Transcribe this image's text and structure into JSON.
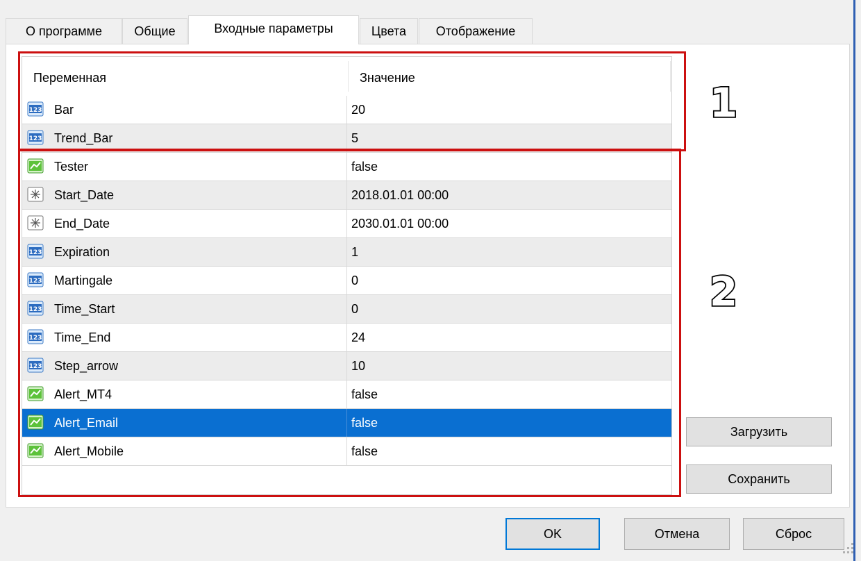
{
  "tabs": [
    {
      "label": "О программе",
      "active": false
    },
    {
      "label": "Общие",
      "active": false
    },
    {
      "label": "Входные параметры",
      "active": true
    },
    {
      "label": "Цвета",
      "active": false
    },
    {
      "label": "Отображение",
      "active": false
    }
  ],
  "grid": {
    "headers": {
      "variable": "Переменная",
      "value": "Значение"
    },
    "rows": [
      {
        "icon": "number-icon",
        "name": "Bar",
        "value": "20"
      },
      {
        "icon": "number-icon",
        "name": "Trend_Bar",
        "value": "5"
      },
      {
        "icon": "boolean-icon",
        "name": "Tester",
        "value": "false"
      },
      {
        "icon": "datetime-icon",
        "name": "Start_Date",
        "value": "2018.01.01 00:00"
      },
      {
        "icon": "datetime-icon",
        "name": "End_Date",
        "value": "2030.01.01 00:00"
      },
      {
        "icon": "number-icon",
        "name": "Expiration",
        "value": "1"
      },
      {
        "icon": "number-icon",
        "name": "Martingale",
        "value": "0"
      },
      {
        "icon": "number-icon",
        "name": "Time_Start",
        "value": "0"
      },
      {
        "icon": "number-icon",
        "name": "Time_End",
        "value": "24"
      },
      {
        "icon": "number-icon",
        "name": "Step_arrow",
        "value": "10"
      },
      {
        "icon": "boolean-icon",
        "name": "Alert_MT4",
        "value": "false"
      },
      {
        "icon": "boolean-icon",
        "name": "Alert_Email",
        "value": "false",
        "selected": true
      },
      {
        "icon": "boolean-icon",
        "name": "Alert_Mobile",
        "value": "false"
      }
    ]
  },
  "annotations": {
    "first": "1",
    "second": "2"
  },
  "buttons": {
    "load": "Загрузить",
    "save": "Сохранить",
    "ok": "OK",
    "cancel": "Отмена",
    "reset": "Сброс"
  },
  "colors": {
    "selection": "#0a6fd1",
    "highlight_box": "#cc1010",
    "default_button_border": "#0078d7"
  }
}
